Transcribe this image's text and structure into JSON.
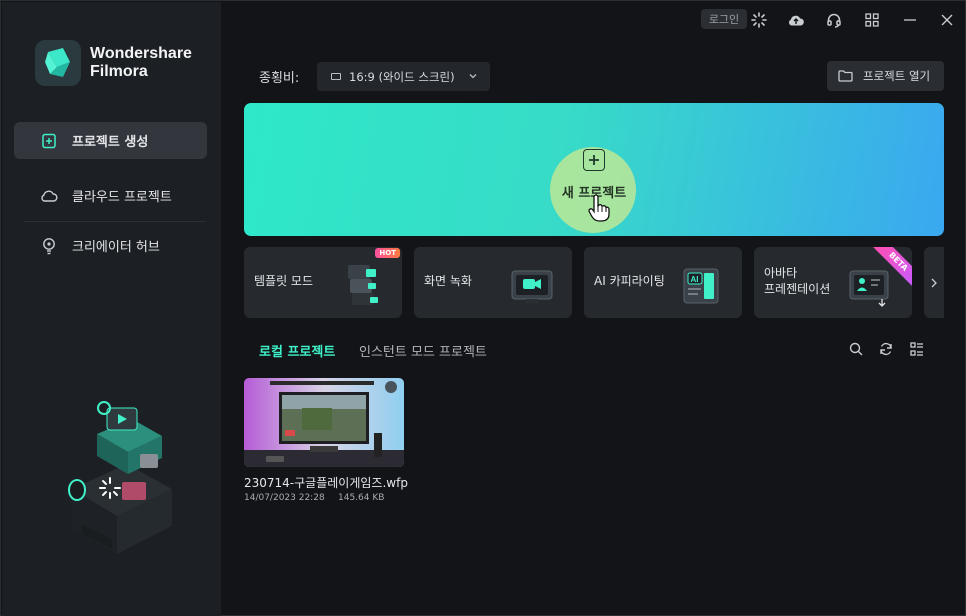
{
  "app": {
    "brand_line1": "Wondershare",
    "brand_line2": "Filmora",
    "brand_color": "#2fe3c4"
  },
  "sidebar": {
    "items": [
      {
        "label": "프로젝트 생성",
        "icon": "new-file-icon",
        "active": true
      },
      {
        "label": "클라우드 프로젝트",
        "icon": "cloud-icon",
        "active": false
      },
      {
        "label": "크리에이터 허브",
        "icon": "lightbulb-icon",
        "active": false
      }
    ]
  },
  "topbar": {
    "login_label": "로그인",
    "icons": [
      "loading-spinner-icon",
      "cloud-upload-icon",
      "headset-icon",
      "apps-grid-icon",
      "minimize-icon",
      "close-icon"
    ]
  },
  "toolbar": {
    "ratio_label": "종횡비:",
    "ratio_value": "16:9 (와이드 스크린)",
    "open_project_label": "프로젝트 열기"
  },
  "hero": {
    "new_project_label": "새 프로젝트",
    "gradient_start": "#2ee8c9",
    "gradient_end": "#3aa8f0"
  },
  "features": [
    {
      "label": "템플릿 모드",
      "badge": "HOT",
      "icon": "template-icon"
    },
    {
      "label": "화면 녹화",
      "badge": "",
      "icon": "screen-record-icon"
    },
    {
      "label": "AI 카피라이팅",
      "badge": "",
      "icon": "ai-copywriting-icon"
    },
    {
      "label_line1": "아바타",
      "label_line2": "프레젠테이션",
      "badge": "BETA",
      "icon": "avatar-icon"
    }
  ],
  "tabs": {
    "local": "로컬 프로젝트",
    "instant": "인스턴트 모드 프로젝트",
    "active_color": "#3ff0c8"
  },
  "projects": [
    {
      "name": "230714-구글플레이게임즈.wfp",
      "date": "14/07/2023 22:28",
      "size": "145.64 KB"
    }
  ]
}
